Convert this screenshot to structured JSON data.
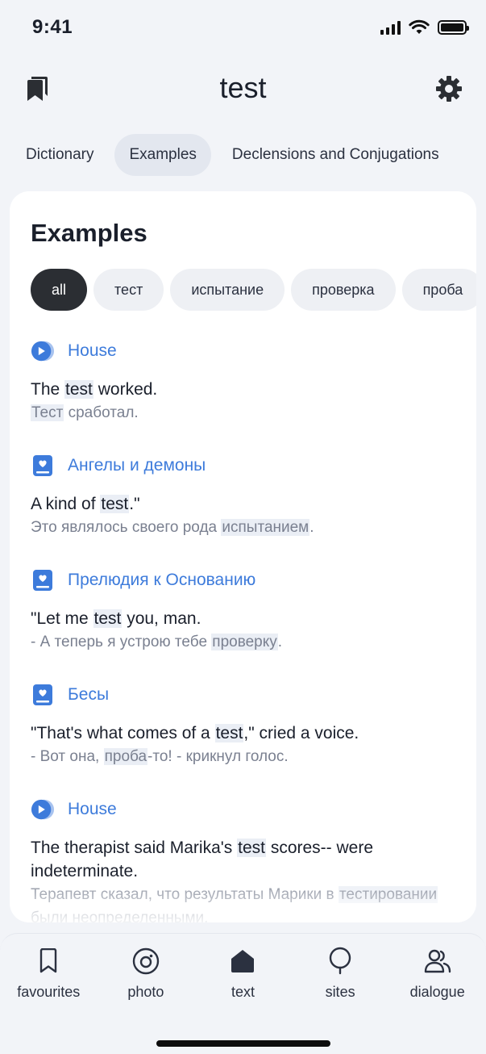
{
  "status": {
    "time": "9:41"
  },
  "header": {
    "title": "test",
    "bookmarks_icon": "bookmarks-icon",
    "settings_icon": "gear-icon"
  },
  "tabs": [
    {
      "label": "Dictionary",
      "active": false
    },
    {
      "label": "Examples",
      "active": true
    },
    {
      "label": "Declensions and Conjugations",
      "active": false
    }
  ],
  "card": {
    "title": "Examples",
    "chips": [
      {
        "label": "all",
        "active": true
      },
      {
        "label": "тест",
        "active": false
      },
      {
        "label": "испытание",
        "active": false
      },
      {
        "label": "проверка",
        "active": false
      },
      {
        "label": "проба",
        "active": false
      }
    ],
    "examples": [
      {
        "source": "House",
        "source_icon": "video-icon",
        "en": [
          "The ",
          "test",
          " worked."
        ],
        "ru": [
          "",
          "Тест",
          " сработал."
        ]
      },
      {
        "source": "Ангелы и демоны",
        "source_icon": "book-icon",
        "en": [
          "A kind of ",
          "test",
          ".\""
        ],
        "ru": [
          "Это являлось своего рода ",
          "испытанием",
          "."
        ]
      },
      {
        "source": "Прелюдия к Основанию",
        "source_icon": "book-icon",
        "en": [
          "\"Let me ",
          "test",
          " you, man."
        ],
        "ru": [
          "- А теперь я устрою тебе ",
          "проверку",
          "."
        ]
      },
      {
        "source": "Бесы",
        "source_icon": "book-icon",
        "en": [
          "\"That's what comes of a ",
          "test",
          ",\" cried a voice."
        ],
        "ru": [
          "- Вот она, ",
          "проба",
          "-то! - крикнул голос."
        ]
      },
      {
        "source": "House",
        "source_icon": "video-icon",
        "en": [
          "The therapist said Marika's ",
          "test",
          " scores-- were indeterminate."
        ],
        "ru": [
          "Терапевт сказал, что результаты Марики в ",
          "тестировании",
          " были неопределенными."
        ]
      }
    ]
  },
  "bottom_nav": [
    {
      "label": "favourites",
      "icon": "bookmark-icon"
    },
    {
      "label": "photo",
      "icon": "camera-icon"
    },
    {
      "label": "text",
      "icon": "home-icon",
      "active": true
    },
    {
      "label": "sites",
      "icon": "speech-bubble-icon"
    },
    {
      "label": "dialogue",
      "icon": "users-icon"
    }
  ],
  "colors": {
    "accent": "#3d7bdb",
    "active_chip": "#2b2e33",
    "background": "#f2f4f8"
  }
}
